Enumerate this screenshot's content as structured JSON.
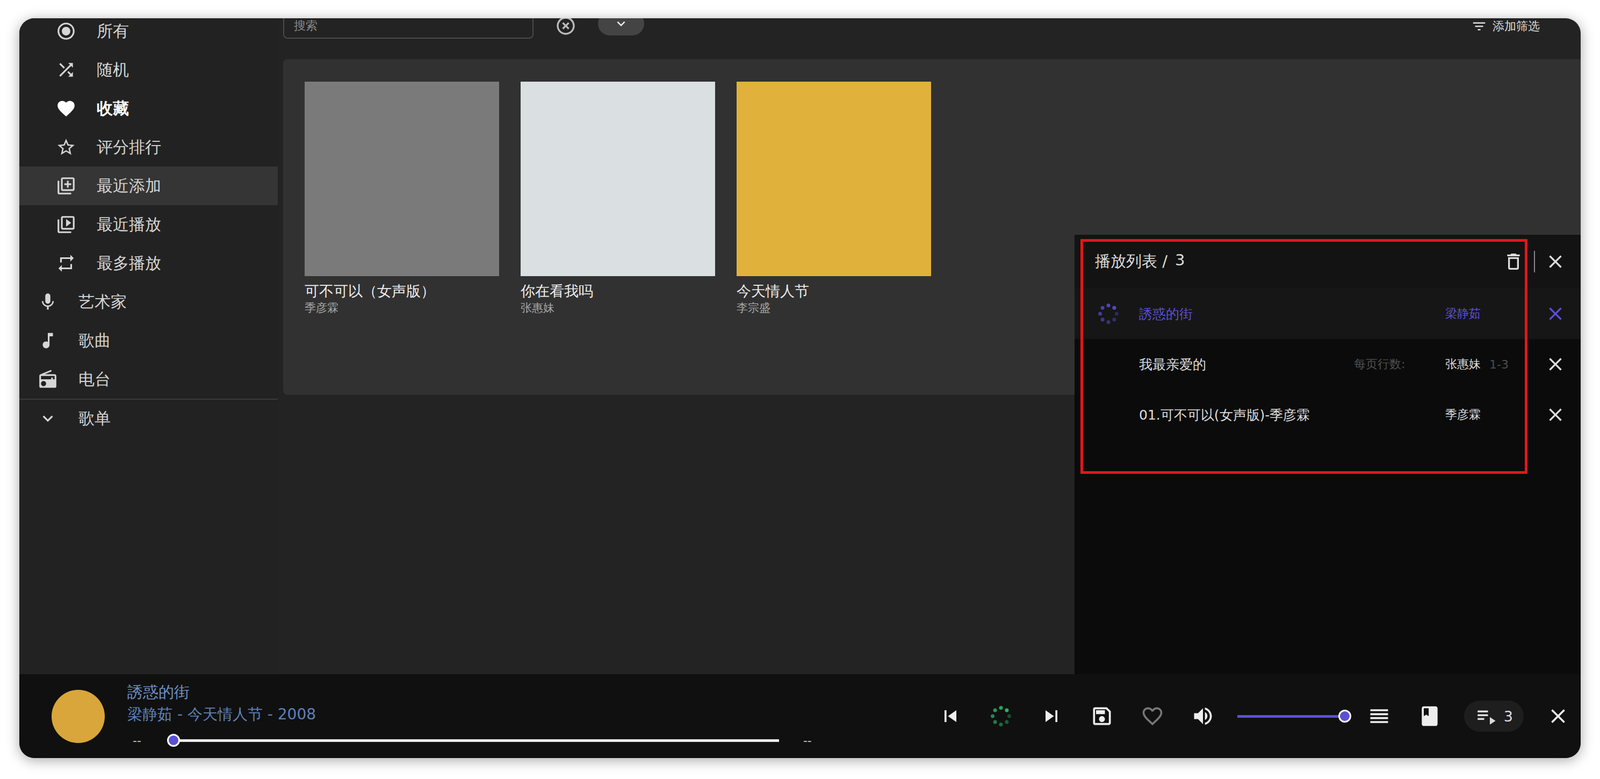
{
  "toolbar": {
    "search_placeholder": "搜索",
    "filter_button": "添加筛选"
  },
  "sidebar": {
    "items": [
      {
        "label": "所有",
        "kind": "sub",
        "selected": false,
        "hovered": false
      },
      {
        "label": "随机",
        "kind": "sub",
        "selected": false,
        "hovered": false
      },
      {
        "label": "收藏",
        "kind": "sub",
        "selected": true,
        "hovered": false
      },
      {
        "label": "评分排行",
        "kind": "sub",
        "selected": false,
        "hovered": false
      },
      {
        "label": "最近添加",
        "kind": "sub",
        "selected": false,
        "hovered": true
      },
      {
        "label": "最近播放",
        "kind": "sub",
        "selected": false,
        "hovered": false
      },
      {
        "label": "最多播放",
        "kind": "sub",
        "selected": false,
        "hovered": false
      },
      {
        "label": "艺术家",
        "kind": "section",
        "selected": false,
        "hovered": false
      },
      {
        "label": "歌曲",
        "kind": "section",
        "selected": false,
        "hovered": false
      },
      {
        "label": "电台",
        "kind": "section",
        "selected": false,
        "hovered": false
      },
      {
        "label": "歌单",
        "kind": "group",
        "selected": false,
        "hovered": false,
        "expanded": false
      }
    ]
  },
  "albums": [
    {
      "title": "可不可以（女声版）",
      "artist": "季彦霖",
      "color": "#7a7a7a"
    },
    {
      "title": "你在看我吗",
      "artist": "张惠妹",
      "color": "#dadfe2"
    },
    {
      "title": "今天情人节",
      "artist": "李宗盛",
      "color": "#e0b23c"
    }
  ],
  "pagination": {
    "label": "每页行数:",
    "range": "1-3"
  },
  "play_queue": {
    "title": "播放列表 /",
    "count": "3",
    "rows": [
      {
        "title": "誘惑的街",
        "artist": "梁静茹",
        "current": true
      },
      {
        "title": "我最亲爱的",
        "artist": "张惠妹",
        "current": false
      },
      {
        "title": "01.可不可以(女声版)-季彦霖",
        "artist": "季彦霖",
        "current": false
      }
    ]
  },
  "player": {
    "title": "誘惑的街",
    "subtitle": "梁静茹 - 今天情人节 - 2008",
    "elapsed": "--",
    "duration": "--",
    "progress": 0,
    "volume": 1,
    "liked": false,
    "loading": true,
    "queue_count": "3",
    "cover_color": "#d8a63a"
  }
}
